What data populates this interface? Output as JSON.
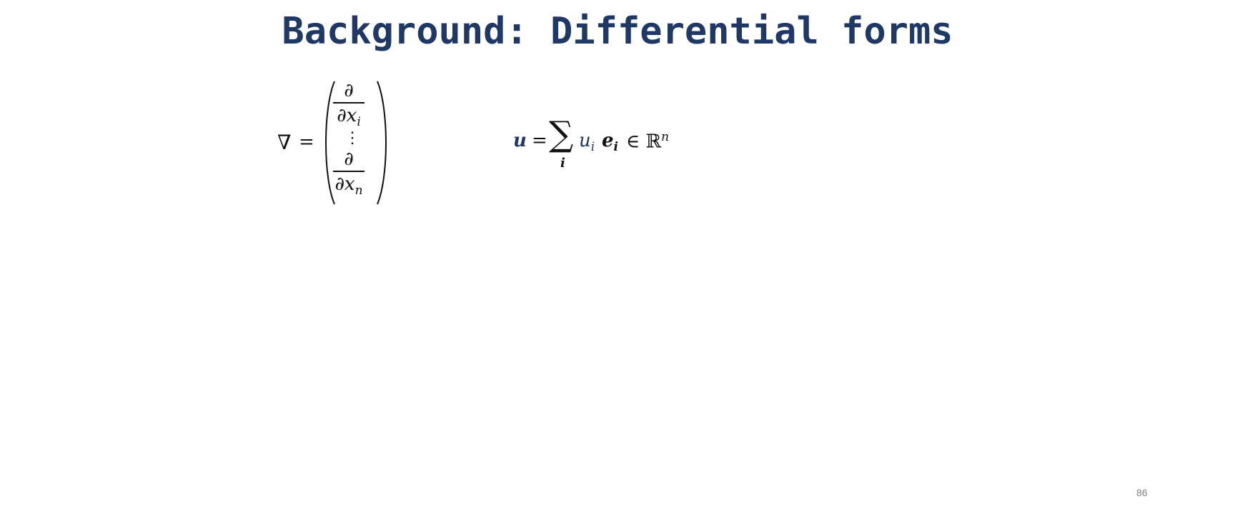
{
  "slide": {
    "title": "Background: Differential forms",
    "page_number": "86"
  },
  "nabla_definition": {
    "symbol": "∇",
    "equals": "=",
    "first_numerator": "∂",
    "first_denominator": "∂x",
    "first_index": "i",
    "dots": "⋮",
    "last_numerator": "∂",
    "last_denominator": "∂x",
    "last_index": "n"
  },
  "vector_definition": {
    "lhs": "u",
    "equals": "=",
    "sum": "∑",
    "sum_index": "i",
    "component": "u",
    "component_index": "i",
    "basis": "e",
    "basis_index": "i",
    "membership": "∈ ℝ",
    "dimension": "n"
  },
  "colors": {
    "title": "#1f3864",
    "accent": "#1f3864",
    "page_number": "#808080"
  }
}
